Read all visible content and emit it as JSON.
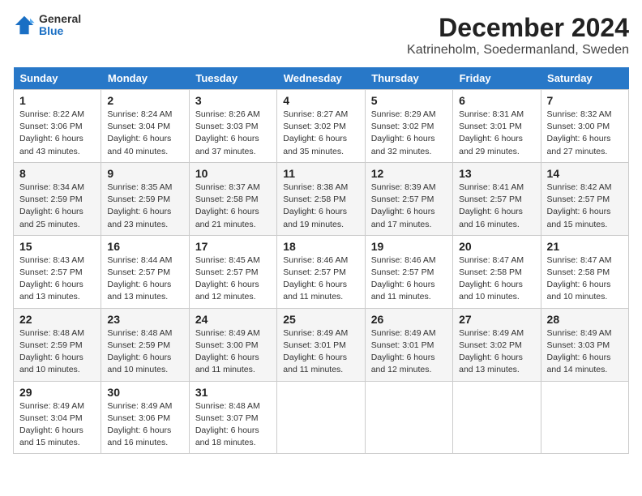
{
  "logo": {
    "line1": "General",
    "line2": "Blue"
  },
  "title": "December 2024",
  "subtitle": "Katrineholm, Soedermanland, Sweden",
  "headers": [
    "Sunday",
    "Monday",
    "Tuesday",
    "Wednesday",
    "Thursday",
    "Friday",
    "Saturday"
  ],
  "weeks": [
    [
      {
        "day": "1",
        "sunrise": "8:22 AM",
        "sunset": "3:06 PM",
        "daylight": "6 hours and 43 minutes."
      },
      {
        "day": "2",
        "sunrise": "8:24 AM",
        "sunset": "3:04 PM",
        "daylight": "6 hours and 40 minutes."
      },
      {
        "day": "3",
        "sunrise": "8:26 AM",
        "sunset": "3:03 PM",
        "daylight": "6 hours and 37 minutes."
      },
      {
        "day": "4",
        "sunrise": "8:27 AM",
        "sunset": "3:02 PM",
        "daylight": "6 hours and 35 minutes."
      },
      {
        "day": "5",
        "sunrise": "8:29 AM",
        "sunset": "3:02 PM",
        "daylight": "6 hours and 32 minutes."
      },
      {
        "day": "6",
        "sunrise": "8:31 AM",
        "sunset": "3:01 PM",
        "daylight": "6 hours and 29 minutes."
      },
      {
        "day": "7",
        "sunrise": "8:32 AM",
        "sunset": "3:00 PM",
        "daylight": "6 hours and 27 minutes."
      }
    ],
    [
      {
        "day": "8",
        "sunrise": "8:34 AM",
        "sunset": "2:59 PM",
        "daylight": "6 hours and 25 minutes."
      },
      {
        "day": "9",
        "sunrise": "8:35 AM",
        "sunset": "2:59 PM",
        "daylight": "6 hours and 23 minutes."
      },
      {
        "day": "10",
        "sunrise": "8:37 AM",
        "sunset": "2:58 PM",
        "daylight": "6 hours and 21 minutes."
      },
      {
        "day": "11",
        "sunrise": "8:38 AM",
        "sunset": "2:58 PM",
        "daylight": "6 hours and 19 minutes."
      },
      {
        "day": "12",
        "sunrise": "8:39 AM",
        "sunset": "2:57 PM",
        "daylight": "6 hours and 17 minutes."
      },
      {
        "day": "13",
        "sunrise": "8:41 AM",
        "sunset": "2:57 PM",
        "daylight": "6 hours and 16 minutes."
      },
      {
        "day": "14",
        "sunrise": "8:42 AM",
        "sunset": "2:57 PM",
        "daylight": "6 hours and 15 minutes."
      }
    ],
    [
      {
        "day": "15",
        "sunrise": "8:43 AM",
        "sunset": "2:57 PM",
        "daylight": "6 hours and 13 minutes."
      },
      {
        "day": "16",
        "sunrise": "8:44 AM",
        "sunset": "2:57 PM",
        "daylight": "6 hours and 13 minutes."
      },
      {
        "day": "17",
        "sunrise": "8:45 AM",
        "sunset": "2:57 PM",
        "daylight": "6 hours and 12 minutes."
      },
      {
        "day": "18",
        "sunrise": "8:46 AM",
        "sunset": "2:57 PM",
        "daylight": "6 hours and 11 minutes."
      },
      {
        "day": "19",
        "sunrise": "8:46 AM",
        "sunset": "2:57 PM",
        "daylight": "6 hours and 11 minutes."
      },
      {
        "day": "20",
        "sunrise": "8:47 AM",
        "sunset": "2:58 PM",
        "daylight": "6 hours and 10 minutes."
      },
      {
        "day": "21",
        "sunrise": "8:47 AM",
        "sunset": "2:58 PM",
        "daylight": "6 hours and 10 minutes."
      }
    ],
    [
      {
        "day": "22",
        "sunrise": "8:48 AM",
        "sunset": "2:59 PM",
        "daylight": "6 hours and 10 minutes."
      },
      {
        "day": "23",
        "sunrise": "8:48 AM",
        "sunset": "2:59 PM",
        "daylight": "6 hours and 10 minutes."
      },
      {
        "day": "24",
        "sunrise": "8:49 AM",
        "sunset": "3:00 PM",
        "daylight": "6 hours and 11 minutes."
      },
      {
        "day": "25",
        "sunrise": "8:49 AM",
        "sunset": "3:01 PM",
        "daylight": "6 hours and 11 minutes."
      },
      {
        "day": "26",
        "sunrise": "8:49 AM",
        "sunset": "3:01 PM",
        "daylight": "6 hours and 12 minutes."
      },
      {
        "day": "27",
        "sunrise": "8:49 AM",
        "sunset": "3:02 PM",
        "daylight": "6 hours and 13 minutes."
      },
      {
        "day": "28",
        "sunrise": "8:49 AM",
        "sunset": "3:03 PM",
        "daylight": "6 hours and 14 minutes."
      }
    ],
    [
      {
        "day": "29",
        "sunrise": "8:49 AM",
        "sunset": "3:04 PM",
        "daylight": "6 hours and 15 minutes."
      },
      {
        "day": "30",
        "sunrise": "8:49 AM",
        "sunset": "3:06 PM",
        "daylight": "6 hours and 16 minutes."
      },
      {
        "day": "31",
        "sunrise": "8:48 AM",
        "sunset": "3:07 PM",
        "daylight": "6 hours and 18 minutes."
      },
      null,
      null,
      null,
      null
    ]
  ],
  "labels": {
    "sunrise": "Sunrise:",
    "sunset": "Sunset:",
    "daylight": "Daylight:"
  }
}
